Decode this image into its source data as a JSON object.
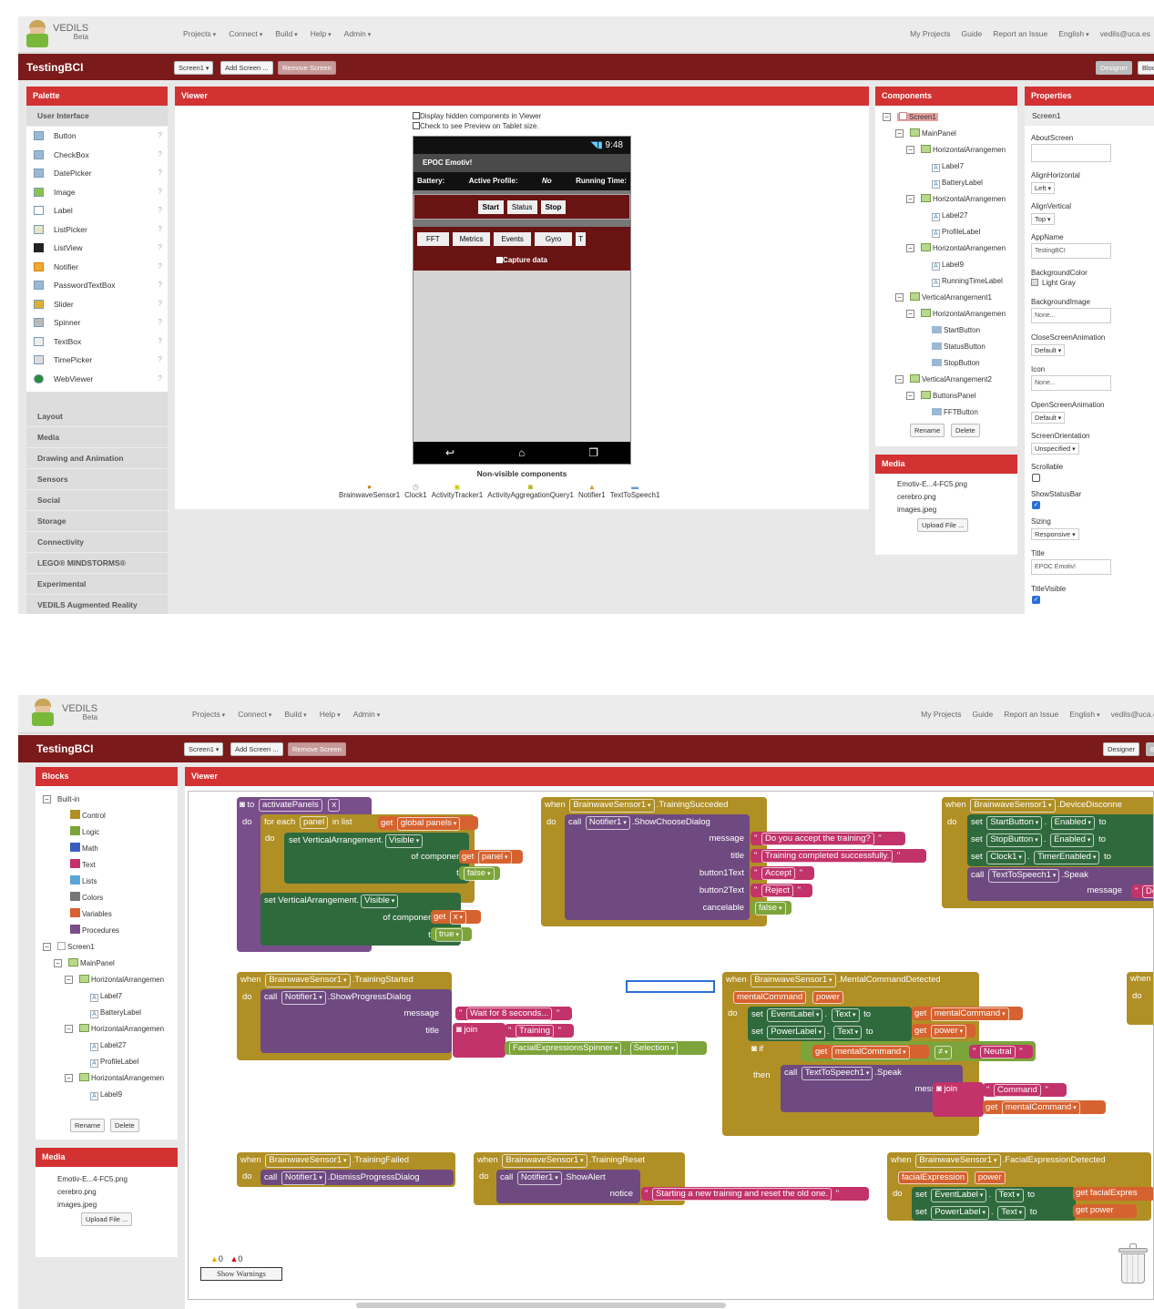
{
  "app": {
    "name": "VEDILS",
    "beta": "Beta",
    "project": "TestingBCI"
  },
  "menu": [
    "Projects",
    "Connect",
    "Build",
    "Help",
    "Admin"
  ],
  "right_menu": {
    "my_projects": "My Projects",
    "guide": "Guide",
    "report": "Report an Issue",
    "language": "English",
    "user": "vedils@uca.es"
  },
  "toolbar": {
    "screen": "Screen1",
    "add_screen": "Add Screen ...",
    "remove_screen": "Remove Screen",
    "designer": "Designer",
    "blocks": "Blocks"
  },
  "palette": {
    "title": "Palette",
    "category": "User Interface",
    "items": [
      "Button",
      "CheckBox",
      "DatePicker",
      "Image",
      "Label",
      "ListPicker",
      "ListView",
      "Notifier",
      "PasswordTextBox",
      "Slider",
      "Spinner",
      "TextBox",
      "TimePicker",
      "WebViewer"
    ],
    "categories": [
      "Layout",
      "Media",
      "Drawing and Animation",
      "Sensors",
      "Social",
      "Storage",
      "Connectivity",
      "LEGO® MINDSTORMS®",
      "Experimental",
      "VEDILS Augmented Reality"
    ]
  },
  "viewer": {
    "title": "Viewer",
    "opt1": "Display hidden components in Viewer",
    "opt2": "Check to see Preview on Tablet size.",
    "phone": {
      "time": "9:48",
      "app_title": "EPOC Emotiv!",
      "battery": "Battery:",
      "active_profile": "Active Profile:",
      "no": "No",
      "running_time": "Running Time:",
      "buttons": [
        "Start",
        "Status",
        "Stop"
      ],
      "tabs": [
        "FFT",
        "Metrics",
        "Events",
        "Gyro",
        "T"
      ],
      "capture": "Capture data"
    },
    "nonvisible_title": "Non-visible components",
    "nonvisible": [
      "BrainwaveSensor1",
      "Clock1",
      "ActivityTracker1",
      "ActivityAggregationQuery1",
      "Notifier1",
      "TextToSpeech1"
    ]
  },
  "components": {
    "title": "Components",
    "tree": [
      "Screen1",
      "MainPanel",
      "HorizontalArrangemen",
      "Label7",
      "BatteryLabel",
      "HorizontalArrangemen",
      "Label27",
      "ProfileLabel",
      "HorizontalArrangemen",
      "Label9",
      "RunningTimeLabel",
      "VerticalArrangement1",
      "HorizontalArrangemen",
      "StartButton",
      "StatusButton",
      "StopButton",
      "VerticalArrangement2",
      "ButtonsPanel",
      "FFTButton"
    ],
    "rename": "Rename",
    "delete": "Delete"
  },
  "media": {
    "title": "Media",
    "files": [
      "Emotiv-E...4-FC5.png",
      "cerebro.png",
      "images.jpeg"
    ],
    "upload": "Upload File ..."
  },
  "properties": {
    "title": "Properties",
    "screen": "Screen1",
    "about": "AboutScreen",
    "alignh": "AlignHorizontal",
    "alignh_v": "Left",
    "alignv": "AlignVertical",
    "alignv_v": "Top",
    "appname": "AppName",
    "appname_v": "TestingBCI",
    "bgcolor": "BackgroundColor",
    "bgcolor_v": "Light Gray",
    "bgimage": "BackgroundImage",
    "bgimage_v": "None...",
    "closeanim": "CloseScreenAnimation",
    "closeanim_v": "Default",
    "icon": "Icon",
    "icon_v": "None...",
    "openanim": "OpenScreenAnimation",
    "openanim_v": "Default",
    "orient": "ScreenOrientation",
    "orient_v": "Unspecified",
    "scroll": "Scrollable",
    "statusbar": "ShowStatusBar",
    "sizing": "Sizing",
    "sizing_v": "Responsive",
    "title_l": "Title",
    "title_v": "EPOC Emotiv!",
    "titlevis": "TitleVisible"
  },
  "blocks_panel": {
    "title": "Blocks",
    "builtin": "Built-in",
    "items": [
      {
        "label": "Control",
        "color": "#b08f25"
      },
      {
        "label": "Logic",
        "color": "#7ca43a"
      },
      {
        "label": "Math",
        "color": "#3a5ec0"
      },
      {
        "label": "Text",
        "color": "#c2336b"
      },
      {
        "label": "Lists",
        "color": "#5aa6d9"
      },
      {
        "label": "Colors",
        "color": "#777777"
      },
      {
        "label": "Variables",
        "color": "#d6622f"
      },
      {
        "label": "Procedures",
        "color": "#7a4e8a"
      }
    ],
    "tree": [
      "Screen1",
      "MainPanel",
      "HorizontalArrangemen",
      "Label7",
      "BatteryLabel",
      "HorizontalArrangemen",
      "Label27",
      "ProfileLabel",
      "HorizontalArrangemen",
      "Label9"
    ]
  },
  "warnings": {
    "w": "0",
    "e": "0",
    "show": "Show Warnings"
  },
  "code": {
    "b1": {
      "to": "to",
      "name": "activatePanels",
      "x": "x",
      "do": "do",
      "foreach": "for each",
      "panel": "panel",
      "inlist": "in list",
      "get": "get",
      "gpanels": "global panels",
      "setva": "set VerticalArrangement.",
      "visible": "Visible",
      "ofc": "of component",
      "to2": "to",
      "false": "false",
      "true": "true"
    },
    "b2": {
      "when": "when",
      "comp": "BrainwaveSensor1",
      "ev": ".TrainingSucceded",
      "call": "call",
      "notif": "Notifier1",
      "meth": ".ShowChooseDialog",
      "message": "message",
      "title": "title",
      "b1t": "button1Text",
      "b2t": "button2Text",
      "canc": "cancelable",
      "m": "Do you accept the training?",
      "t": "Training completed successfully.",
      "accept": "Accept",
      "reject": "Reject",
      "false": "false"
    },
    "b3": {
      "ev": ".DeviceDisconne",
      "s1": "StartButton",
      "s2": "StopButton",
      "s3": "Clock1",
      "enabled": "Enabled",
      "timer": "TimerEnabled",
      "set": "set",
      "tts": "TextToSpeech1",
      "speak": ".Speak",
      "message": "message",
      "de": "De"
    },
    "b4": {
      "ev": ".TrainingStarted",
      "meth": ".ShowProgressDialog",
      "m": "Wait for 8 seconds...",
      "join": "join",
      "training": "Training",
      "spinner": "FacialExpressionsSpinner",
      "selection": "Selection"
    },
    "b5": {
      "ev": ".MentalCommandDetected",
      "p1": "mentalCommand",
      "p2": "power",
      "event": "EventLabel",
      "text": "Text",
      "power": "PowerLabel",
      "if": "if",
      "then": "then",
      "neq": "≠",
      "neutral": "Neutral",
      "command": "Command"
    },
    "b6": {
      "ev": ".TrainingFailed",
      "meth": ".DismissProgressDialog"
    },
    "b7": {
      "ev": ".TrainingReset",
      "meth": ".ShowAlert",
      "notice": "notice",
      "m": "Starting a new training and reset the old one."
    },
    "b8": {
      "ev": ".FacialExpressionDetected",
      "p1": "facialExpression",
      "p2": "power",
      "get_fe": "get facialExpres",
      "get_pw": "get power"
    }
  }
}
